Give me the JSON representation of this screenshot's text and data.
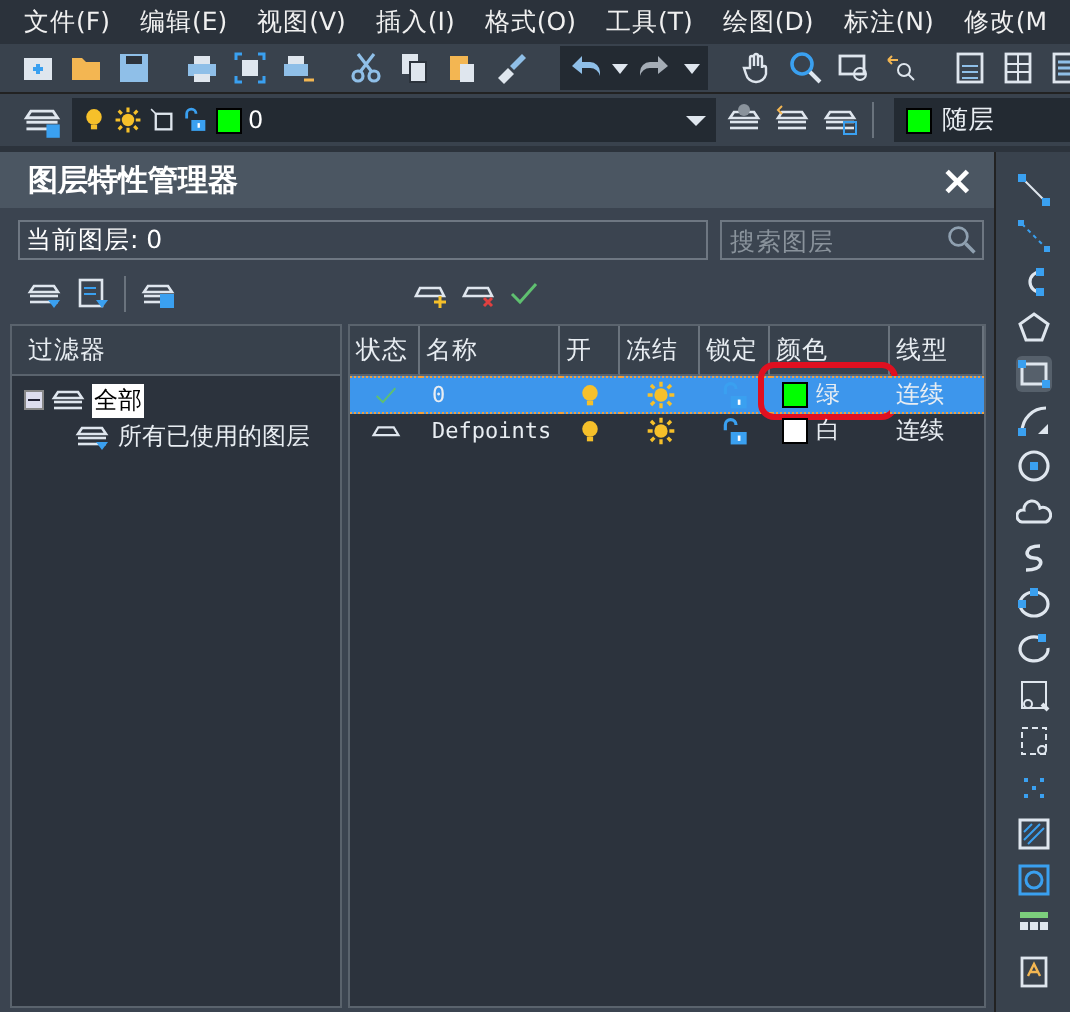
{
  "menu": [
    {
      "label": "文件(F)"
    },
    {
      "label": "编辑(E)"
    },
    {
      "label": "视图(V)"
    },
    {
      "label": "插入(I)"
    },
    {
      "label": "格式(O)"
    },
    {
      "label": "工具(T)"
    },
    {
      "label": "绘图(D)"
    },
    {
      "label": "标注(N)"
    },
    {
      "label": "修改(M"
    }
  ],
  "layer_bar": {
    "layer": {
      "name": "0",
      "color": "#00ff00"
    },
    "current_color": {
      "label": "随层",
      "color": "#00ff00"
    }
  },
  "panel": {
    "title": "图层特性管理器",
    "close": "×",
    "current_layer": "当前图层: 0",
    "search": {
      "placeholder": "搜索图层"
    },
    "filters": {
      "header": "过滤器",
      "tree": [
        {
          "label": "全部",
          "selected": true,
          "expanded": true,
          "children": [
            {
              "label": "所有已使用的图层",
              "selected": false
            }
          ]
        }
      ]
    },
    "layers": {
      "columns": [
        "状态",
        "名称",
        "开",
        "冻结",
        "锁定",
        "颜色",
        "线型"
      ],
      "rows": [
        {
          "current": true,
          "selected": true,
          "name": "0",
          "on": true,
          "frozen": false,
          "locked": false,
          "color": "#00ff00",
          "color_name": "绿",
          "linetype": "连续",
          "annotated": true
        },
        {
          "current": false,
          "selected": false,
          "name": "Defpoints",
          "on": true,
          "frozen": false,
          "locked": false,
          "color": "#ffffff",
          "color_name": "白",
          "linetype": "连续",
          "annotated": false
        }
      ]
    }
  }
}
